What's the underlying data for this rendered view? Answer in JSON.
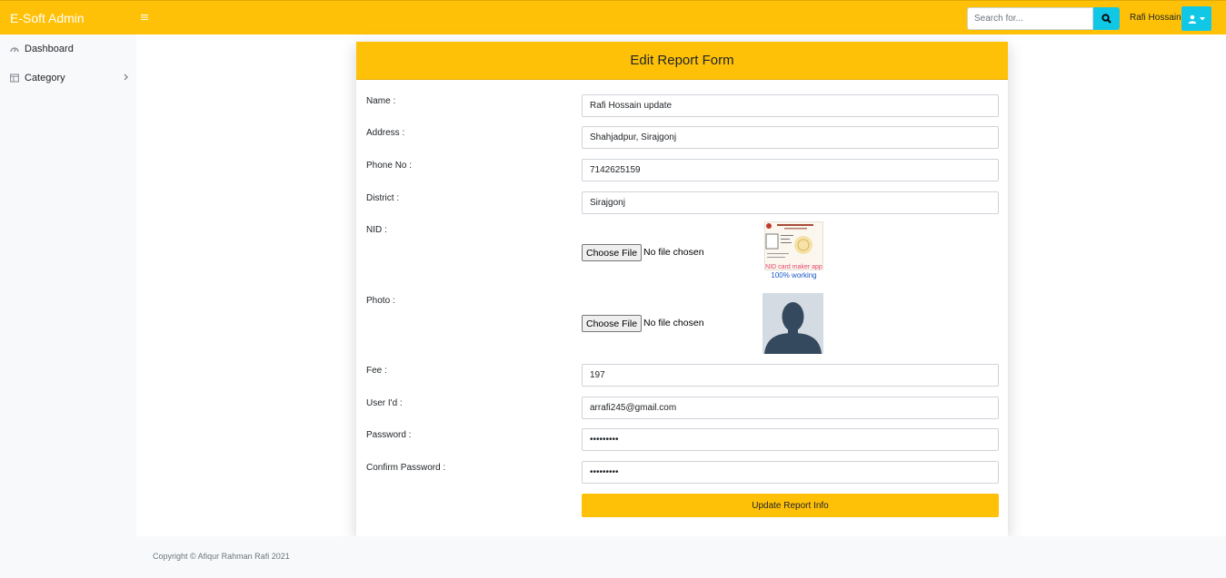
{
  "app": {
    "brand": "E-Soft Admin",
    "colors": {
      "accent": "#ffc107",
      "info": "#11c7e6",
      "sidebar_bg": "#f8f9fa"
    }
  },
  "topbar": {
    "search": {
      "placeholder": "Search for...",
      "value": "",
      "icon": "search-icon"
    },
    "user_name": "Rafi Hossain",
    "user_icon": "user-icon"
  },
  "sidebar": {
    "items": [
      {
        "label": "Dashboard",
        "icon": "dashboard-icon"
      },
      {
        "label": "Category",
        "icon": "columns-icon",
        "has_children": true
      }
    ]
  },
  "form": {
    "title": "Edit Report Form",
    "name": {
      "label": "Name :",
      "value": "Rafi Hossain update"
    },
    "address": {
      "label": "Address :",
      "value": "Shahjadpur, Sirajgonj"
    },
    "phone": {
      "label": "Phone No :",
      "value": "7142625159"
    },
    "district": {
      "label": "District :",
      "value": "Sirajgonj"
    },
    "nid": {
      "label": "NID :",
      "button": "Choose File",
      "status": "No file chosen"
    },
    "photo": {
      "label": "Photo :",
      "button": "Choose File",
      "status": "No file chosen"
    },
    "fee": {
      "label": "Fee :",
      "value": "197"
    },
    "user_id": {
      "label": "User I'd :",
      "value": "arrafi245@gmail.com"
    },
    "password": {
      "label": "Password :",
      "value": "•••••••••"
    },
    "confirm_password": {
      "label": "Confirm Password :",
      "value": "•••••••••"
    },
    "submit": "Update Report Info",
    "nid_thumb": {
      "caption_line1": "NID card maker app",
      "caption_line2": "100% working"
    }
  },
  "footer": {
    "text": "Copyright © Afiqur Rahman Rafi 2021"
  }
}
